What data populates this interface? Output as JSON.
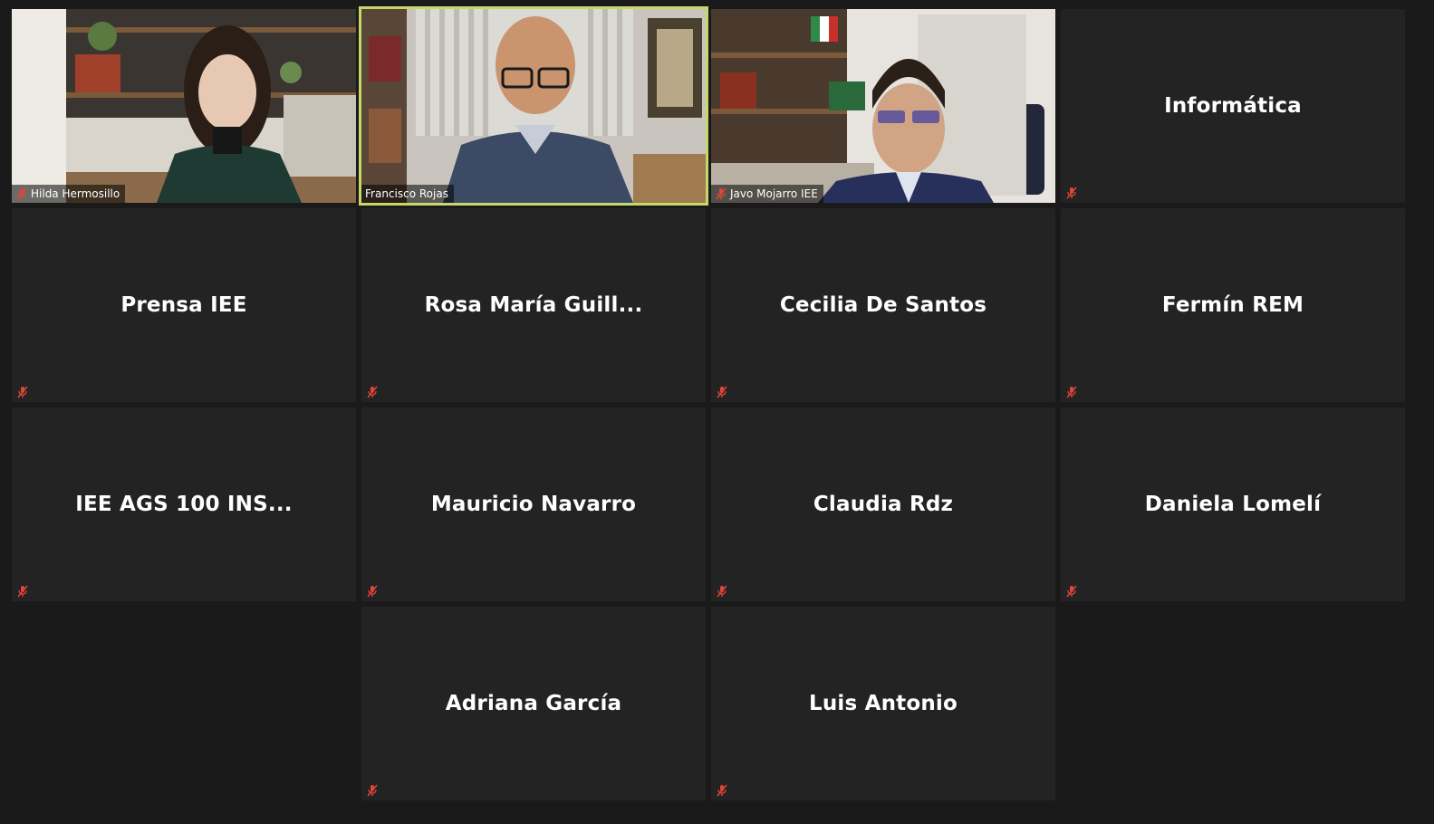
{
  "participants": [
    {
      "name": "Hilda Hermosillo",
      "video": true,
      "muted": true
    },
    {
      "name": "Francisco Rojas",
      "video": true,
      "muted": false,
      "speaking": true
    },
    {
      "name": "Javo Mojarro IEE",
      "video": true,
      "muted": true
    },
    {
      "name": "Informática",
      "video": false,
      "muted": true
    },
    {
      "name": "Prensa IEE",
      "video": false,
      "muted": true
    },
    {
      "name": "Rosa María Guill...",
      "video": false,
      "muted": true
    },
    {
      "name": "Cecilia De Santos",
      "video": false,
      "muted": true
    },
    {
      "name": "Fermín REM",
      "video": false,
      "muted": true
    },
    {
      "name": "IEE AGS 100 INS...",
      "video": false,
      "muted": true
    },
    {
      "name": "Mauricio Navarro",
      "video": false,
      "muted": true
    },
    {
      "name": "Claudia Rdz",
      "video": false,
      "muted": true
    },
    {
      "name": "Daniela Lomelí",
      "video": false,
      "muted": true
    },
    {
      "name": "Adriana García",
      "video": false,
      "muted": true
    },
    {
      "name": "Luis Antonio",
      "video": false,
      "muted": true
    }
  ],
  "icons": {
    "muted": "microphone-muted-icon"
  },
  "colors": {
    "background": "#1a1a1a",
    "tile": "#232323",
    "active_speaker_border": "#c6d86a",
    "muted_icon": "#e0453a"
  }
}
